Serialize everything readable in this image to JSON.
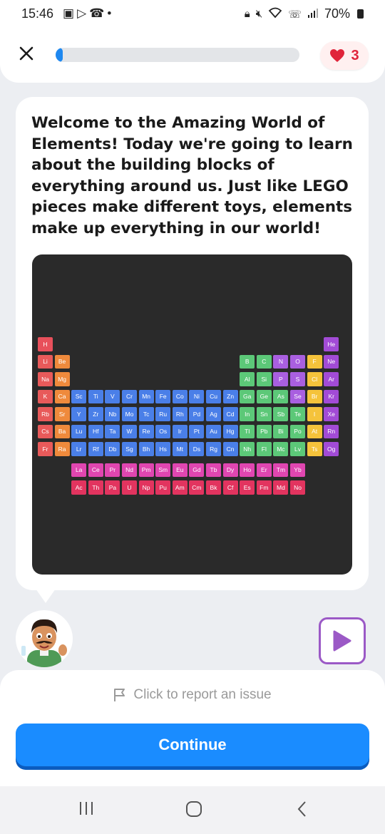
{
  "status_bar": {
    "time": "15:46",
    "left_icons": [
      "gallery-icon",
      "play-store-icon",
      "missed-call-icon",
      "dot-icon"
    ],
    "right_icons": [
      "lock-icon",
      "mute-icon",
      "wifi-icon",
      "call-icon",
      "signal-icon"
    ],
    "battery": "70%"
  },
  "top_bar": {
    "close_icon": "close-icon",
    "progress": 0.03,
    "hearts": "3",
    "accent": "#1e88f0",
    "heart_color": "#e0243a"
  },
  "lesson": {
    "intro": "Welcome to the Amazing World of Elements! Today we're going to learn about the building blocks of everything around us. Just like LEGO pieces make different toys, elements make up everything in our world!"
  },
  "periodic_table": {
    "rows": [
      [
        "H",
        "",
        "",
        "",
        "",
        "",
        "",
        "",
        "",
        "",
        "",
        "",
        "",
        "",
        "",
        "",
        "",
        "He"
      ],
      [
        "Li",
        "Be",
        "",
        "",
        "",
        "",
        "",
        "",
        "",
        "",
        "",
        "",
        "B",
        "C",
        "N",
        "O",
        "F",
        "Ne"
      ],
      [
        "Na",
        "Mg",
        "",
        "",
        "",
        "",
        "",
        "",
        "",
        "",
        "",
        "",
        "Al",
        "Si",
        "P",
        "S",
        "Cl",
        "Ar"
      ],
      [
        "K",
        "Ca",
        "Sc",
        "Ti",
        "V",
        "Cr",
        "Mn",
        "Fe",
        "Co",
        "Ni",
        "Cu",
        "Zn",
        "Ga",
        "Ge",
        "As",
        "Se",
        "Br",
        "Kr"
      ],
      [
        "Rb",
        "Sr",
        "Y",
        "Zr",
        "Nb",
        "Mo",
        "Tc",
        "Ru",
        "Rh",
        "Pd",
        "Ag",
        "Cd",
        "In",
        "Sn",
        "Sb",
        "Te",
        "I",
        "Xe"
      ],
      [
        "Cs",
        "Ba",
        "Lu",
        "Hf",
        "Ta",
        "W",
        "Re",
        "Os",
        "Ir",
        "Pt",
        "Au",
        "Hg",
        "Tl",
        "Pb",
        "Bi",
        "Po",
        "At",
        "Rn"
      ],
      [
        "Fr",
        "Ra",
        "Lr",
        "Rf",
        "Db",
        "Sg",
        "Bh",
        "Hs",
        "Mt",
        "Ds",
        "Rg",
        "Cn",
        "Nh",
        "Fl",
        "Mc",
        "Lv",
        "Ts",
        "Og"
      ]
    ],
    "lanthanides": [
      "La",
      "Ce",
      "Pr",
      "Nd",
      "Pm",
      "Sm",
      "Eu",
      "Gd",
      "Tb",
      "Dy",
      "Ho",
      "Er",
      "Tm",
      "Yb"
    ],
    "actinides": [
      "Ac",
      "Th",
      "Pa",
      "U",
      "Np",
      "Pu",
      "Am",
      "Cm",
      "Bk",
      "Cf",
      "Es",
      "Fm",
      "Md",
      "No"
    ],
    "colors": {
      "hydrogen": "#e8505b",
      "alkali": "#e85a5a",
      "alkaline": "#ef8a3c",
      "transition": "#4a7fe8",
      "metalloid": "#5cc878",
      "poor_metal": "#5cc878",
      "nonmetal": "#a95fe0",
      "halogen": "#f5c33b",
      "noble": "#a24bd6",
      "lanthanide": "#e046b0",
      "actinide": "#e2345f"
    }
  },
  "tutor": {
    "avatar_icon": "teacher-avatar-icon",
    "play_icon": "play-icon",
    "play_color": "#9b59c6"
  },
  "footer": {
    "report_label": "Click to report an issue",
    "report_icon": "flag-icon",
    "continue_label": "Continue",
    "continue_color": "#1a8cff"
  },
  "nav": {
    "icons": [
      "recents-icon",
      "home-icon",
      "back-icon"
    ]
  }
}
